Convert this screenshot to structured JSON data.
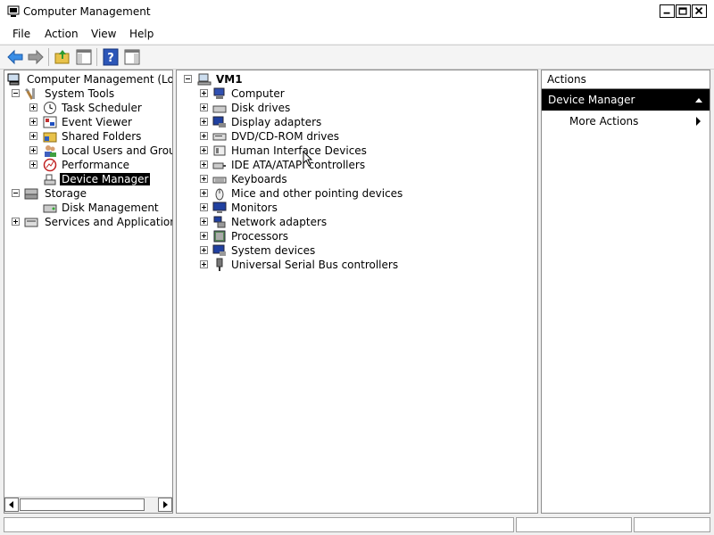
{
  "window": {
    "title": "Computer Management"
  },
  "menu": {
    "file": "File",
    "action": "Action",
    "view": "View",
    "help": "Help"
  },
  "left_tree": {
    "root": "Computer Management (Local)",
    "system_tools": "System Tools",
    "task_scheduler": "Task Scheduler",
    "event_viewer": "Event Viewer",
    "shared_folders": "Shared Folders",
    "local_users": "Local Users and Groups",
    "performance": "Performance",
    "device_manager": "Device Manager",
    "storage": "Storage",
    "disk_management": "Disk Management",
    "services": "Services and Applications"
  },
  "center_tree": {
    "root": "VM1",
    "items": [
      "Computer",
      "Disk drives",
      "Display adapters",
      "DVD/CD-ROM drives",
      "Human Interface Devices",
      "IDE ATA/ATAPI controllers",
      "Keyboards",
      "Mice and other pointing devices",
      "Monitors",
      "Network adapters",
      "Processors",
      "System devices",
      "Universal Serial Bus controllers"
    ]
  },
  "actions": {
    "header": "Actions",
    "section": "Device Manager",
    "more": "More Actions"
  },
  "icons": {
    "back": "back-arrow-icon",
    "forward": "forward-arrow-icon",
    "up": "up-folder-icon",
    "show_hide": "show-hide-tree-icon",
    "help": "help-icon",
    "properties": "properties-icon"
  }
}
